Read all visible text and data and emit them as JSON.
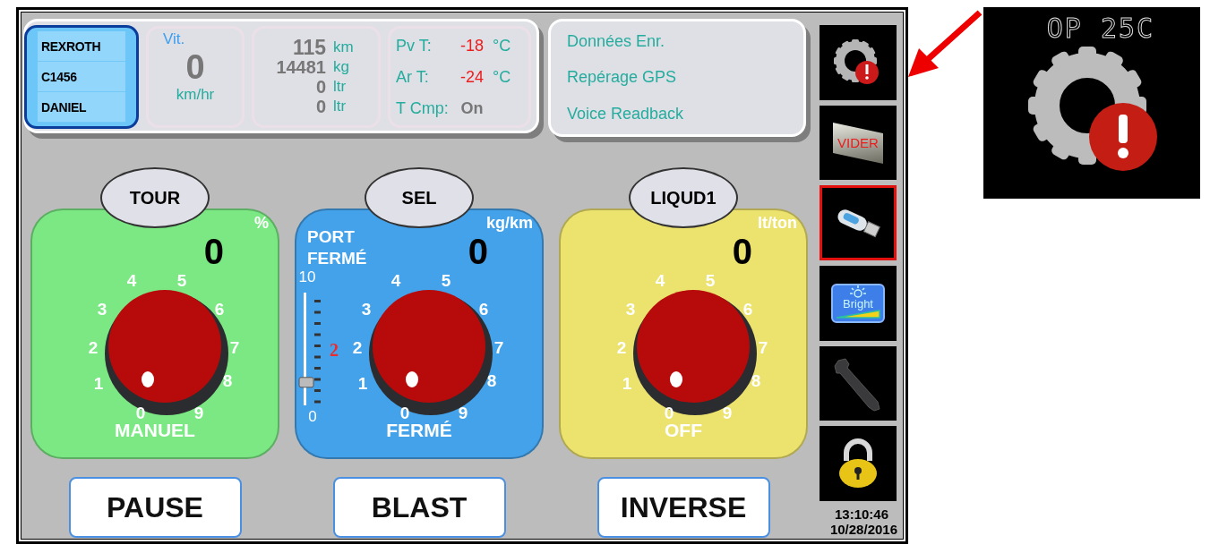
{
  "header": {
    "operator": [
      "REXROTH",
      "C1456",
      "DANIEL"
    ],
    "speed": {
      "label": "Vit.",
      "value": "0",
      "unit": "km/hr"
    },
    "totals": [
      {
        "value": "115",
        "unit": "km"
      },
      {
        "value": "14481",
        "unit": "kg"
      },
      {
        "value": "0",
        "unit": "ltr"
      },
      {
        "value": "0",
        "unit": "ltr"
      }
    ],
    "temps": [
      {
        "label": "Pv T:",
        "value": "-18",
        "unit": "°C"
      },
      {
        "label": "Ar T:",
        "value": "-24",
        "unit": "°C"
      },
      {
        "label": "T Cmp:",
        "value": "On"
      }
    ]
  },
  "links": [
    "Données Enr.",
    "Repérage GPS",
    "Voice Readback"
  ],
  "dials": [
    {
      "title": "TOUR",
      "unit": "%",
      "value": "0",
      "mode": "MANUEL",
      "color": "#7be884",
      "scale": [
        "0",
        "1",
        "2",
        "3",
        "4",
        "5",
        "6",
        "7",
        "8",
        "9"
      ]
    },
    {
      "title": "SEL",
      "unit": "kg/km",
      "value": "0",
      "mode": "FERMÉ",
      "color": "#44a2ea",
      "status": "PORT FERMÉ",
      "scale": [
        "0",
        "1",
        "2",
        "3",
        "4",
        "5",
        "6",
        "7",
        "8",
        "9"
      ],
      "slider": {
        "max_label": "10",
        "min_label": "0",
        "marker": "2",
        "level": 0.2
      }
    },
    {
      "title": "LIQUD1",
      "unit": "lt/ton",
      "value": "0",
      "mode": "OFF",
      "color": "#ece26e",
      "scale": [
        "0",
        "1",
        "2",
        "3",
        "4",
        "5",
        "6",
        "7",
        "8",
        "9"
      ]
    }
  ],
  "buttons": [
    "PAUSE",
    "BLAST",
    "INVERSE"
  ],
  "side_buttons": [
    {
      "kind": "gear-alert",
      "selected": false
    },
    {
      "kind": "vider",
      "label": "VIDER",
      "selected": false
    },
    {
      "kind": "usb",
      "selected": true
    },
    {
      "kind": "bright",
      "label": "Bright",
      "selected": false
    },
    {
      "kind": "wrench",
      "selected": false
    },
    {
      "kind": "lock",
      "selected": false
    }
  ],
  "clock": {
    "time": "13:10:46",
    "date": "10/28/2016"
  },
  "inset": {
    "caption": "OP 25C"
  }
}
